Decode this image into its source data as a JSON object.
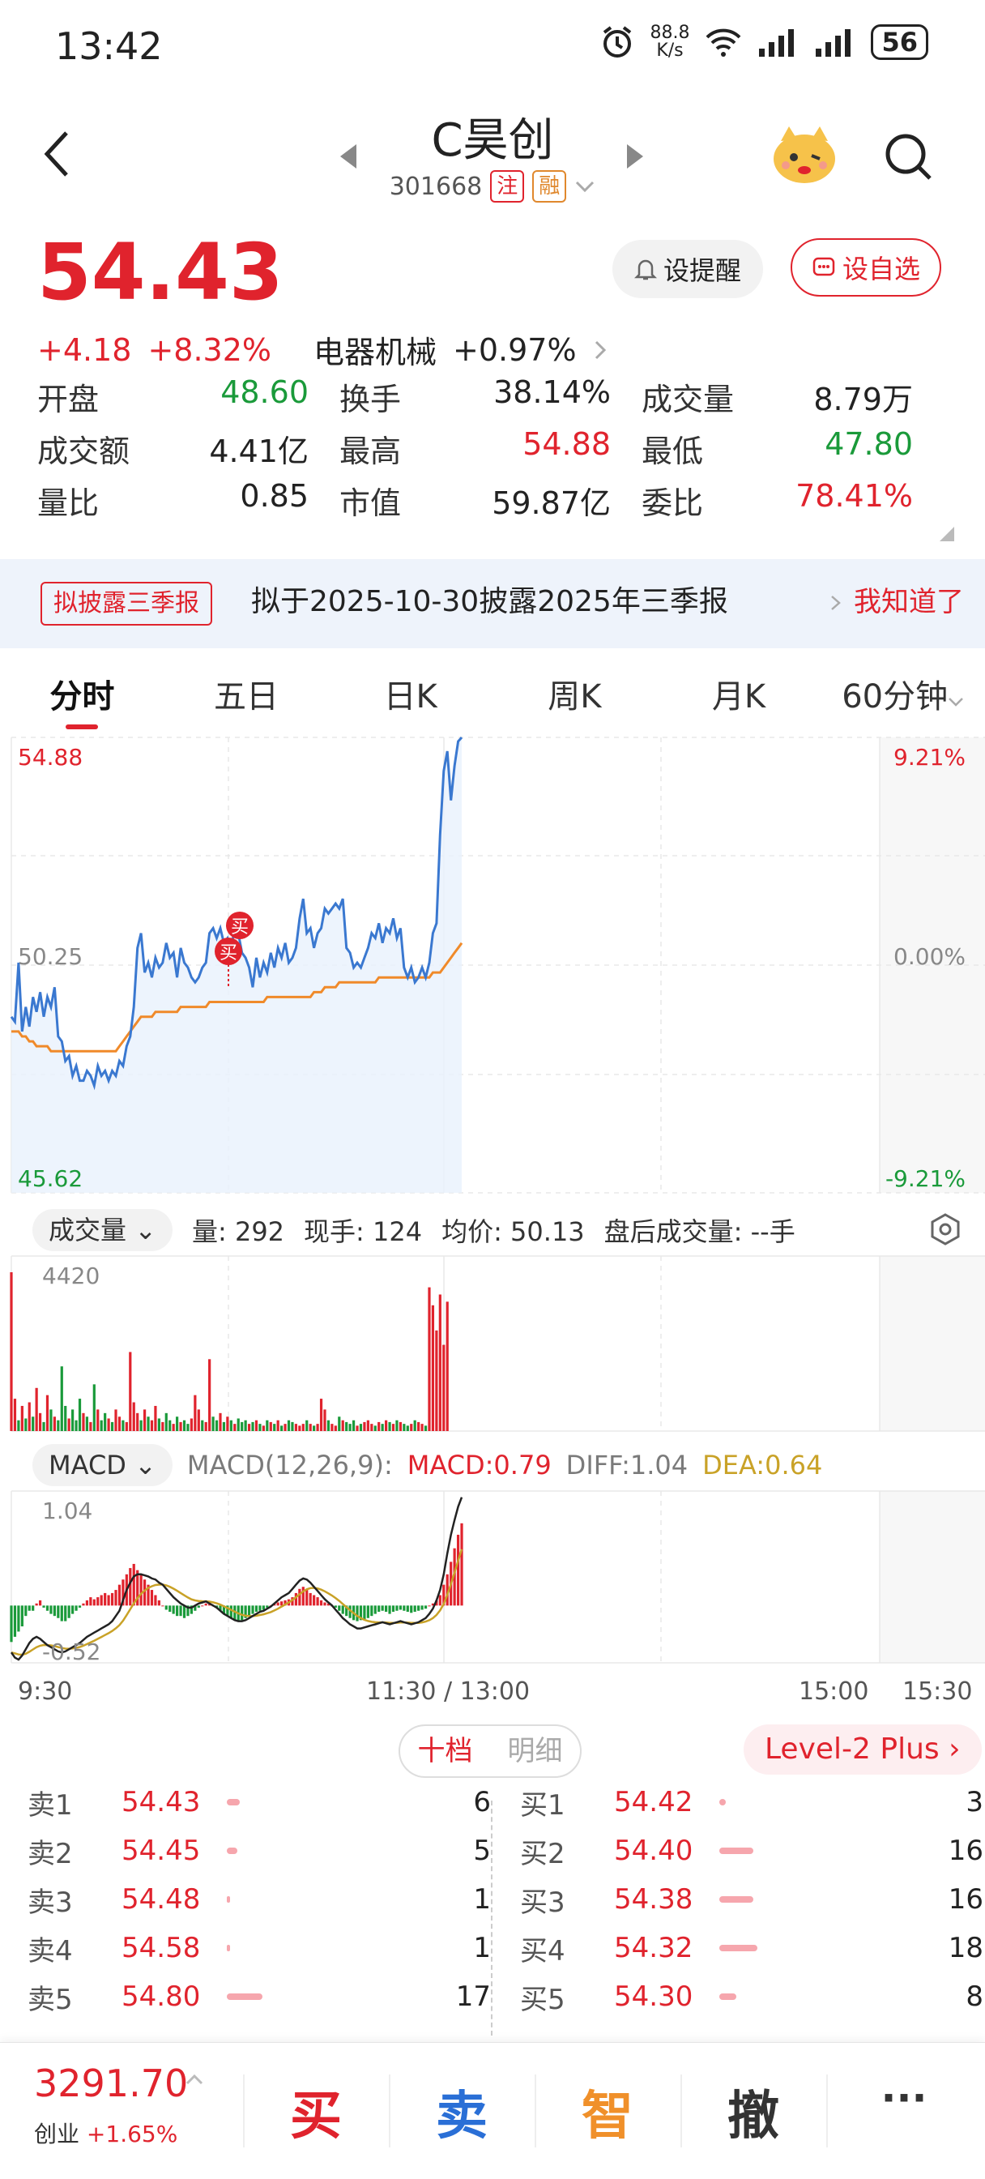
{
  "status_bar": {
    "time": "13:42",
    "net_speed_top": "88.8",
    "net_speed_bottom": "K/s",
    "battery": "56"
  },
  "header": {
    "name": "C昊创",
    "code": "301668",
    "tag_zhu": "注",
    "tag_rong": "融"
  },
  "quote": {
    "price": "54.43",
    "change": "+4.18",
    "change_pct": "+8.32%",
    "sector": "电器机械",
    "sector_pct": "+0.97%",
    "alert_label": "设提醒",
    "watch_label": "设自选"
  },
  "stats": [
    [
      {
        "label": "开盘",
        "value": "48.60",
        "color": "green"
      },
      {
        "label": "换手",
        "value": "38.14%",
        "color": "dark"
      },
      {
        "label": "成交量",
        "value": "8.79万",
        "color": "dark"
      }
    ],
    [
      {
        "label": "成交额",
        "value": "4.41亿",
        "color": "dark"
      },
      {
        "label": "最高",
        "value": "54.88",
        "color": "red"
      },
      {
        "label": "最低",
        "value": "47.80",
        "color": "green"
      }
    ],
    [
      {
        "label": "量比",
        "value": "0.85",
        "color": "dark"
      },
      {
        "label": "市值",
        "value": "59.87亿",
        "color": "dark"
      },
      {
        "label": "委比",
        "value": "78.41%",
        "color": "red"
      }
    ]
  ],
  "notice": {
    "tag": "拟披露三季报",
    "text": "拟于2025-10-30披露2025年三季报",
    "link": "我知道了"
  },
  "tabs": [
    "分时",
    "五日",
    "日K",
    "周K",
    "月K",
    "60分钟"
  ],
  "chart_labels": {
    "price_high": "54.88",
    "price_mid": "50.25",
    "price_low": "45.62",
    "pct_high": "9.21%",
    "pct_mid": "0.00%",
    "pct_low": "-9.21%",
    "buy_marker": "买",
    "vol_max": "4420",
    "macd_max": "1.04",
    "macd_min": "-0.52"
  },
  "volume_info": {
    "selector": "成交量",
    "qty": "量: 292",
    "now": "现手: 124",
    "avg": "均价: 50.13",
    "after": "盘后成交量: --手"
  },
  "macd_info": {
    "selector": "MACD",
    "params": "MACD(12,26,9):",
    "macd": "MACD:0.79",
    "diff": "DIFF:1.04",
    "dea": "DEA:0.64"
  },
  "time_axis": [
    "9:30",
    "11:30 / 13:00",
    "15:00",
    "15:30"
  ],
  "colors": {
    "up": "#e0232d",
    "down": "#1a9a3a",
    "price_line": "#3a78d0",
    "avg_line": "#f08a2a",
    "dea_line": "#c9a227"
  },
  "chart_data": {
    "type": "line",
    "price_range": [
      45.62,
      54.88
    ],
    "prev_close": 50.25,
    "series": [
      {
        "name": "price",
        "values": [
          49.2,
          49.1,
          50.3,
          48.9,
          49.4,
          49.0,
          49.6,
          49.3,
          49.7,
          49.2,
          49.6,
          49.4,
          49.8,
          48.8,
          48.7,
          48.3,
          48.4,
          48.0,
          48.2,
          47.9,
          47.9,
          48.1,
          48.0,
          47.8,
          48.2,
          48.0,
          48.1,
          47.9,
          48.1,
          48.0,
          48.3,
          48.2,
          48.6,
          48.8,
          49.4,
          50.6,
          50.9,
          50.1,
          50.3,
          50.0,
          50.4,
          50.2,
          50.3,
          50.7,
          50.4,
          50.5,
          50.0,
          50.6,
          50.3,
          50.2,
          50.0,
          49.9,
          50.0,
          50.2,
          50.3,
          50.9,
          51.0,
          50.8,
          51.0,
          50.7,
          50.8,
          50.6,
          51.0,
          50.9,
          50.5,
          50.4,
          50.2,
          49.8,
          50.4,
          50.0,
          50.3,
          50.1,
          50.5,
          50.2,
          50.6,
          50.4,
          50.7,
          50.3,
          50.4,
          50.6,
          51.2,
          51.6,
          50.9,
          51.0,
          50.6,
          50.9,
          51.0,
          51.4,
          51.3,
          51.4,
          51.5,
          51.4,
          51.6,
          50.6,
          50.5,
          50.2,
          50.3,
          50.2,
          50.4,
          50.6,
          50.9,
          50.8,
          51.1,
          50.7,
          51.0,
          50.9,
          51.2,
          50.8,
          51.0,
          50.2,
          50.0,
          50.2,
          49.9,
          50.0,
          50.2,
          50.0,
          50.3,
          50.9,
          51.1,
          52.9,
          54.2,
          54.6,
          53.6,
          54.3,
          54.8,
          54.88
        ]
      },
      {
        "name": "avg",
        "values": [
          48.9,
          48.9,
          48.9,
          48.8,
          48.8,
          48.7,
          48.7,
          48.6,
          48.6,
          48.6,
          48.6,
          48.5,
          48.5,
          48.5,
          48.5,
          48.5,
          48.5,
          48.5,
          48.5,
          48.5,
          48.5,
          48.5,
          48.5,
          48.5,
          48.5,
          48.5,
          48.5,
          48.5,
          48.5,
          48.5,
          48.6,
          48.7,
          48.8,
          48.9,
          49.0,
          49.1,
          49.2,
          49.2,
          49.2,
          49.2,
          49.3,
          49.3,
          49.3,
          49.3,
          49.3,
          49.3,
          49.3,
          49.4,
          49.4,
          49.4,
          49.4,
          49.4,
          49.4,
          49.4,
          49.4,
          49.5,
          49.5,
          49.5,
          49.5,
          49.5,
          49.5,
          49.5,
          49.5,
          49.5,
          49.5,
          49.5,
          49.5,
          49.5,
          49.5,
          49.5,
          49.5,
          49.6,
          49.6,
          49.6,
          49.6,
          49.6,
          49.6,
          49.6,
          49.6,
          49.6,
          49.6,
          49.6,
          49.6,
          49.6,
          49.7,
          49.7,
          49.7,
          49.8,
          49.8,
          49.8,
          49.8,
          49.9,
          49.9,
          49.9,
          49.9,
          49.9,
          49.9,
          49.9,
          49.9,
          49.9,
          49.9,
          49.9,
          50.0,
          50.0,
          50.0,
          50.0,
          50.0,
          50.0,
          50.0,
          50.0,
          50.0,
          50.0,
          50.0,
          50.0,
          50.0,
          50.0,
          50.0,
          50.1,
          50.1,
          50.1,
          50.2,
          50.3,
          50.4,
          50.5,
          50.6,
          50.7
        ]
      }
    ],
    "volume": [
      4420,
      900,
      300,
      700,
      350,
      800,
      400,
      1200,
      500,
      250,
      1000,
      600,
      400,
      300,
      1800,
      700,
      350,
      600,
      300,
      900,
      500,
      400,
      250,
      1300,
      600,
      300,
      500,
      350,
      250,
      600,
      400,
      300,
      250,
      2200,
      800,
      500,
      300,
      600,
      400,
      300,
      700,
      350,
      250,
      500,
      300,
      200,
      400,
      250,
      300,
      200,
      350,
      1000,
      600,
      300,
      250,
      2000,
      400,
      300,
      500,
      250,
      400,
      300,
      200,
      350,
      250,
      300,
      200,
      250,
      300,
      200,
      150,
      300,
      250,
      200,
      300,
      150,
      200,
      300,
      250,
      200,
      150,
      200,
      300,
      200,
      150,
      200,
      900,
      600,
      300,
      200,
      150,
      400,
      300,
      250,
      200,
      300,
      150,
      200,
      250,
      300,
      200,
      150,
      250,
      200,
      300,
      250,
      200,
      300,
      250,
      200,
      150,
      200,
      300,
      250,
      200,
      150,
      4000,
      3500,
      2800,
      3800,
      2400,
      3600
    ],
    "volume_colors_up": [
      1,
      1,
      0,
      1,
      0,
      1,
      0,
      1,
      1,
      0,
      1,
      0,
      1,
      0,
      0,
      0,
      1,
      0,
      0,
      0,
      1,
      0,
      1,
      0,
      1,
      0,
      0,
      1,
      0,
      1,
      1,
      0,
      1,
      1,
      1,
      1,
      0,
      1,
      0,
      1,
      1,
      0,
      1,
      0,
      0,
      1,
      0,
      1,
      0,
      0,
      1,
      1,
      1,
      0,
      1,
      1,
      0,
      0,
      1,
      0,
      1,
      0,
      1,
      0,
      0,
      0,
      1,
      0,
      1,
      0,
      1,
      0,
      1,
      0,
      1,
      0,
      1,
      0,
      0,
      1,
      1,
      1,
      0,
      1,
      0,
      1,
      1,
      1,
      0,
      1,
      1,
      0,
      1,
      0,
      0,
      0,
      1,
      0,
      1,
      1,
      1,
      0,
      1,
      0,
      1,
      0,
      1,
      0,
      1,
      0,
      0,
      1,
      0,
      1,
      1,
      0,
      1,
      1,
      1,
      1,
      1,
      1,
      0,
      1,
      1,
      1
    ],
    "macd_hist": [
      -0.35,
      -0.3,
      -0.25,
      -0.2,
      -0.1,
      -0.05,
      -0.05,
      0.02,
      0.05,
      -0.02,
      -0.05,
      -0.08,
      -0.1,
      -0.12,
      -0.15,
      -0.15,
      -0.12,
      -0.08,
      -0.05,
      -0.02,
      0.02,
      0.05,
      0.08,
      0.06,
      0.08,
      0.1,
      0.12,
      0.1,
      0.12,
      0.15,
      0.2,
      0.25,
      0.3,
      0.36,
      0.4,
      0.34,
      0.3,
      0.25,
      0.2,
      0.15,
      0.1,
      0.05,
      0.0,
      -0.04,
      -0.06,
      -0.08,
      -0.1,
      -0.1,
      -0.12,
      -0.1,
      -0.08,
      -0.05,
      -0.02,
      0.0,
      0.02,
      0.03,
      0.0,
      -0.02,
      -0.05,
      -0.08,
      -0.1,
      -0.12,
      -0.14,
      -0.15,
      -0.14,
      -0.12,
      -0.1,
      -0.08,
      -0.06,
      -0.05,
      -0.04,
      -0.02,
      0.0,
      0.02,
      0.03,
      0.04,
      0.05,
      0.06,
      0.08,
      0.12,
      0.16,
      0.18,
      0.15,
      0.12,
      0.1,
      0.08,
      0.05,
      0.03,
      0.02,
      0.0,
      -0.02,
      -0.05,
      -0.08,
      -0.1,
      -0.12,
      -0.14,
      -0.15,
      -0.14,
      -0.13,
      -0.12,
      -0.1,
      -0.08,
      -0.06,
      -0.05,
      -0.06,
      -0.08,
      -0.06,
      -0.05,
      -0.04,
      -0.05,
      -0.06,
      -0.07,
      -0.06,
      -0.05,
      -0.04,
      -0.03,
      0.0,
      0.02,
      0.05,
      0.1,
      0.2,
      0.3,
      0.42,
      0.55,
      0.68,
      0.79
    ],
    "diff": [
      -0.45,
      -0.5,
      -0.52,
      -0.48,
      -0.42,
      -0.36,
      -0.32,
      -0.3,
      -0.32,
      -0.35,
      -0.38,
      -0.4,
      -0.42,
      -0.44,
      -0.45,
      -0.44,
      -0.42,
      -0.4,
      -0.38,
      -0.36,
      -0.33,
      -0.3,
      -0.28,
      -0.26,
      -0.24,
      -0.22,
      -0.2,
      -0.18,
      -0.15,
      -0.1,
      -0.05,
      0.05,
      0.15,
      0.22,
      0.28,
      0.3,
      0.3,
      0.29,
      0.28,
      0.26,
      0.25,
      0.22,
      0.2,
      0.16,
      0.12,
      0.08,
      0.05,
      0.02,
      0.0,
      -0.02,
      -0.02,
      0.0,
      0.02,
      0.03,
      0.04,
      0.02,
      0.0,
      -0.02,
      -0.05,
      -0.08,
      -0.1,
      -0.12,
      -0.14,
      -0.15,
      -0.15,
      -0.14,
      -0.12,
      -0.1,
      -0.08,
      -0.06,
      -0.05,
      -0.03,
      -0.01,
      0.02,
      0.05,
      0.08,
      0.1,
      0.12,
      0.16,
      0.2,
      0.24,
      0.26,
      0.25,
      0.22,
      0.18,
      0.14,
      0.1,
      0.06,
      0.03,
      0.0,
      -0.04,
      -0.08,
      -0.12,
      -0.15,
      -0.18,
      -0.2,
      -0.22,
      -0.22,
      -0.21,
      -0.2,
      -0.19,
      -0.18,
      -0.17,
      -0.16,
      -0.17,
      -0.18,
      -0.17,
      -0.16,
      -0.15,
      -0.16,
      -0.17,
      -0.18,
      -0.17,
      -0.16,
      -0.14,
      -0.12,
      -0.08,
      -0.03,
      0.05,
      0.15,
      0.3,
      0.5,
      0.68,
      0.82,
      0.95,
      1.04
    ]
  },
  "depth": {
    "tab_active": "十档",
    "tab_other": "明细",
    "level2": "Level-2 Plus",
    "asks": [
      {
        "label": "卖1",
        "price": "54.43",
        "vol": "6",
        "bar": 0.06
      },
      {
        "label": "卖2",
        "price": "54.45",
        "vol": "5",
        "bar": 0.05
      },
      {
        "label": "卖3",
        "price": "54.48",
        "vol": "1",
        "bar": 0.01
      },
      {
        "label": "卖4",
        "price": "54.58",
        "vol": "1",
        "bar": 0.01
      },
      {
        "label": "卖5",
        "price": "54.80",
        "vol": "17",
        "bar": 0.17
      }
    ],
    "bids": [
      {
        "label": "买1",
        "price": "54.42",
        "vol": "3",
        "bar": 0.03
      },
      {
        "label": "买2",
        "price": "54.40",
        "vol": "16",
        "bar": 0.16
      },
      {
        "label": "买3",
        "price": "54.38",
        "vol": "16",
        "bar": 0.16
      },
      {
        "label": "买4",
        "price": "54.32",
        "vol": "18",
        "bar": 0.18
      },
      {
        "label": "买5",
        "price": "54.30",
        "vol": "8",
        "bar": 0.08
      }
    ]
  },
  "bottom_bar": {
    "index_value": "3291.70",
    "index_name": "创业",
    "index_pct": "+1.65%",
    "buy": "买",
    "sell": "卖",
    "smart": "智",
    "cancel": "撤",
    "more": "···"
  }
}
